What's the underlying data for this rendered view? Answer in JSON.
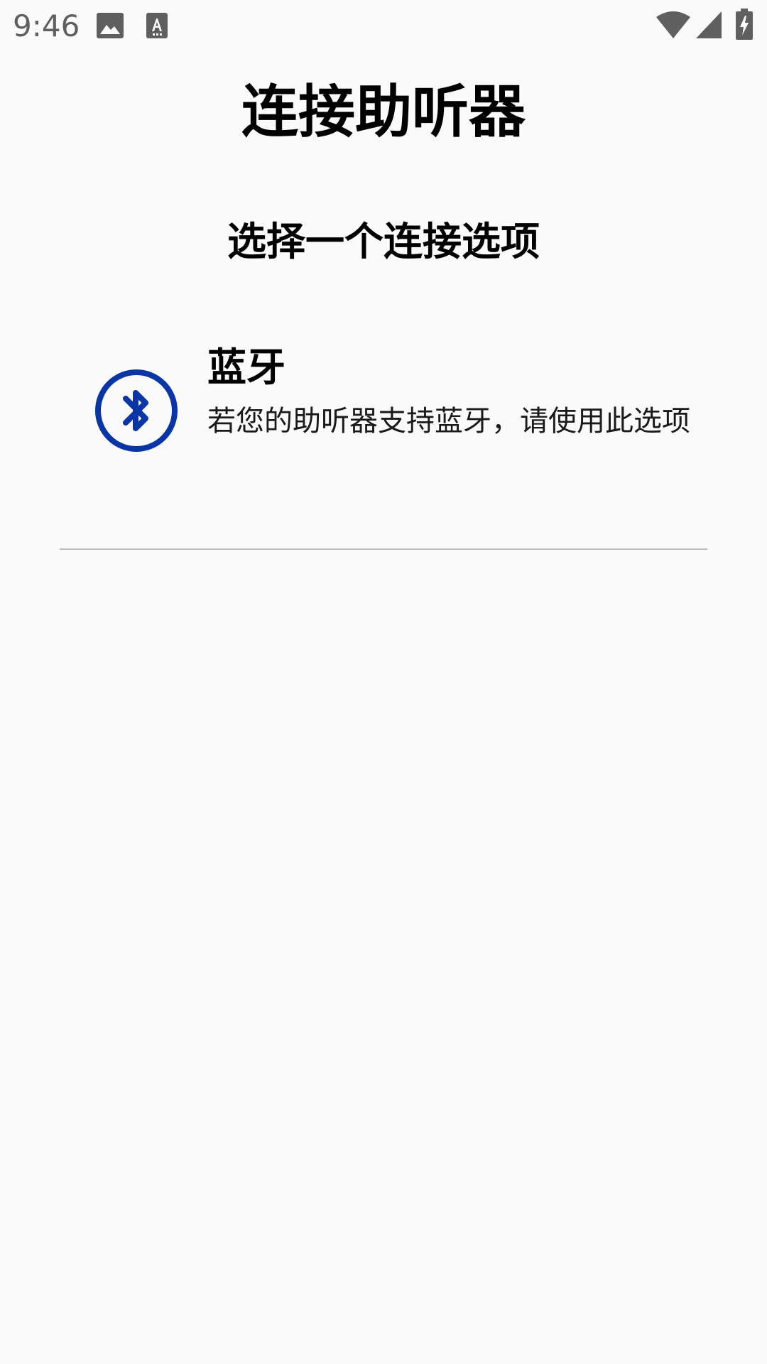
{
  "status_bar": {
    "time": "9:46",
    "icons": [
      "image-icon",
      "text-a-icon",
      "wifi-icon",
      "cell-signal-icon",
      "battery-charging-icon"
    ]
  },
  "title": "连接助听器",
  "section_heading": "选择一个连接选项",
  "options": [
    {
      "icon": "bluetooth-icon",
      "title": "蓝牙",
      "description": "若您的助听器支持蓝牙，请使用此选项"
    }
  ],
  "colors": {
    "bluetooth_accent": "#0a35a6",
    "status_icon": "#5f5f5f",
    "background": "#fafafa",
    "divider": "#bdbdbd"
  }
}
